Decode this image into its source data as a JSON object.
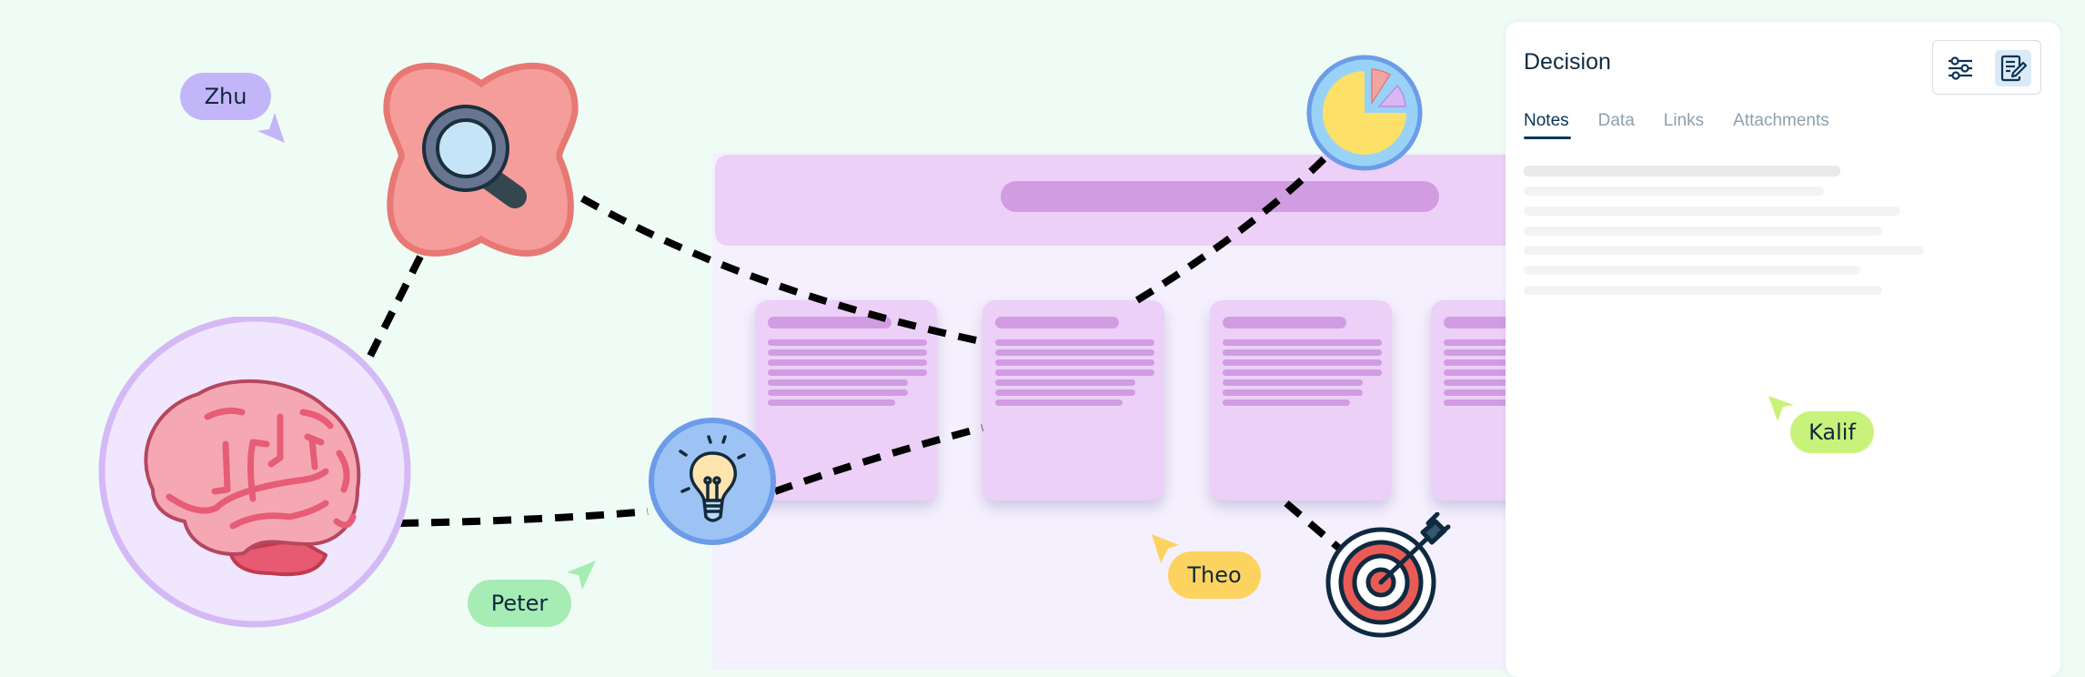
{
  "panel": {
    "title": "Decision",
    "toolbar": [
      {
        "icon": "sliders-icon",
        "label": "Filters",
        "active": false
      },
      {
        "icon": "edit-notes-icon",
        "label": "Edit notes",
        "active": true
      }
    ],
    "tabs": [
      {
        "label": "Notes",
        "active": true
      },
      {
        "label": "Data",
        "active": false
      },
      {
        "label": "Links",
        "active": false
      },
      {
        "label": "Attachments",
        "active": false
      }
    ]
  },
  "collaborators": [
    {
      "name": "Zhu",
      "color": "#c3b6f8"
    },
    {
      "name": "Peter",
      "color": "#a6ecb5"
    },
    {
      "name": "Theo",
      "color": "#fdd35f"
    },
    {
      "name": "Kalif",
      "color": "#c9f27a"
    }
  ],
  "nodes": [
    {
      "icon": "magnifier-icon",
      "shape": "flower",
      "color": "#f59d9a"
    },
    {
      "icon": "brain-icon",
      "shape": "circle",
      "color": "#f0e6fd"
    },
    {
      "icon": "lightbulb-icon",
      "shape": "circle",
      "color": "#9dc3f5"
    },
    {
      "icon": "pie-chart-icon",
      "shape": "circle",
      "color": "#98d2f7"
    },
    {
      "icon": "target-icon",
      "shape": "none",
      "color": "#e95a55"
    }
  ],
  "colors": {
    "background": "#effcf5",
    "board_accent": "#d19ce2",
    "board_surface": "#ecd0f8",
    "ink": "#0d2b45"
  }
}
